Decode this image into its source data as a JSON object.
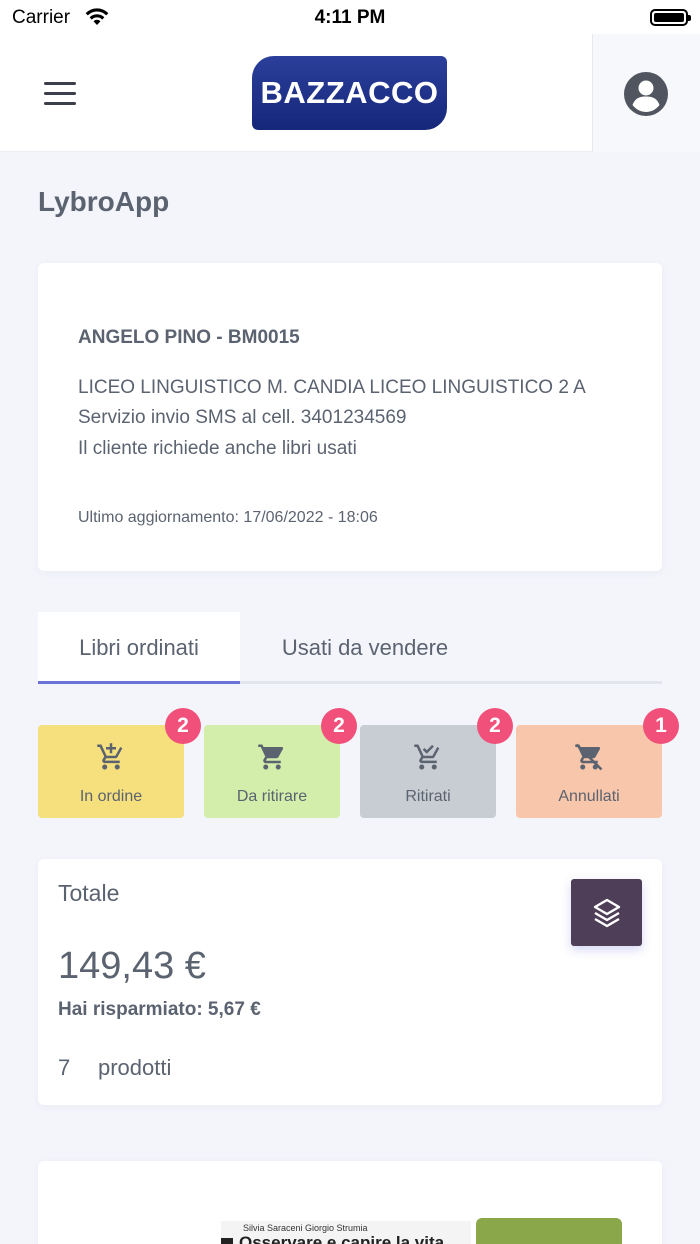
{
  "status_bar": {
    "carrier": "Carrier",
    "time": "4:11 PM",
    "wifi_icon": "wifi-icon",
    "battery_icon": "battery-icon"
  },
  "header": {
    "menu_icon": "hamburger-menu-icon",
    "logo_text": "BAZZACCO",
    "logo_color": "#1f3188",
    "profile_icon": "user-avatar-icon"
  },
  "page": {
    "title": "LybroApp"
  },
  "customer": {
    "name": "ANGELO PINO - BM0015",
    "school": "LICEO LINGUISTICO M. CANDIA LICEO LINGUISTICO 2 A",
    "sms": "Servizio invio SMS al cell. 3401234569",
    "used_books": "Il cliente richiede anche libri usati",
    "last_update": "Ultimo aggiornamento: 17/06/2022 - 18:06"
  },
  "tabs": [
    {
      "label": "Libri ordinati",
      "active": true
    },
    {
      "label": "Usati da vendere",
      "active": false
    }
  ],
  "accent_color": "#6a73d9",
  "status_tiles": [
    {
      "label": "In ordine",
      "count": "2",
      "color": "#f6df7d",
      "icon": "cart-icon"
    },
    {
      "label": "Da ritirare",
      "count": "2",
      "color": "#d3eeaa",
      "icon": "cart-icon"
    },
    {
      "label": "Ritirati",
      "count": "2",
      "color": "#c7cdd3",
      "icon": "cart-check-icon"
    },
    {
      "label": "Annullati",
      "count": "1",
      "color": "#f8c6aa",
      "icon": "cart-remove-icon"
    }
  ],
  "badge_color": "#f0507a",
  "totals": {
    "label": "Totale",
    "amount": "149,43 €",
    "saved": "Hai risparmiato: 5,67 €",
    "count": "7",
    "count_label": "prodotti",
    "layers_icon": "layers-icon"
  },
  "book": {
    "authors": "Silvia Saraceni  Giorgio Strumia",
    "title": "Osservare e capire la vita"
  }
}
